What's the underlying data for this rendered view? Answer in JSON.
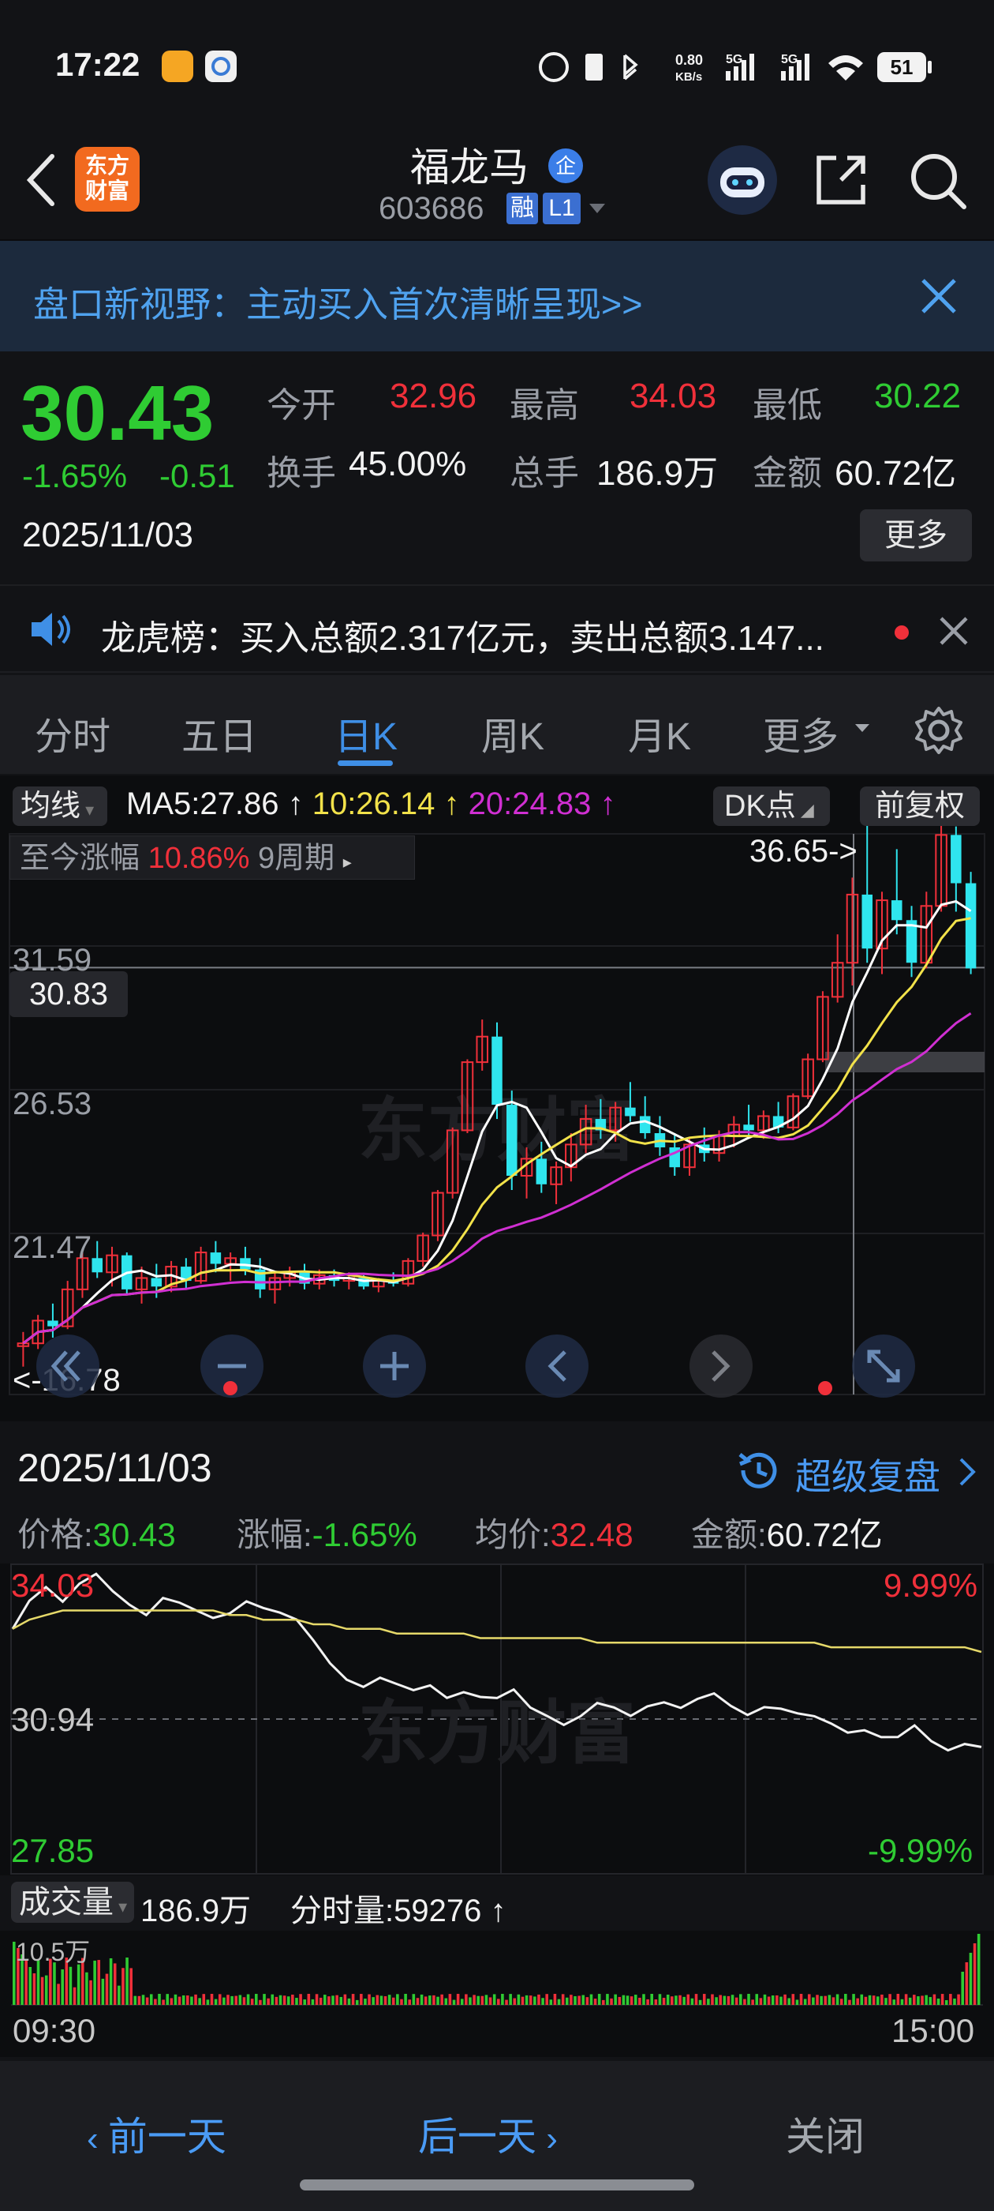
{
  "status_bar": {
    "time": "17:22",
    "net_speed": "0.80",
    "net_unit": "KB/s",
    "sig1": "5G",
    "sig2": "5G",
    "battery": "51"
  },
  "header": {
    "logo_line1": "东方",
    "logo_line2": "财富",
    "stock_name": "福龙马",
    "badge": "企",
    "code": "603686",
    "tag1": "融",
    "tag2": "L1"
  },
  "banner": {
    "text": "盘口新视野：主动买入首次清晰呈现>>"
  },
  "quote": {
    "price": "30.43",
    "change_pct": "-1.65%",
    "change": "-0.51",
    "date": "2025/11/03",
    "open_label": "今开",
    "open": "32.96",
    "high_label": "最高",
    "high": "34.03",
    "low_label": "最低",
    "low": "30.22",
    "turnover_label": "换手",
    "turnover": "45.00%",
    "volume_label": "总手",
    "volume": "186.9万",
    "amount_label": "金额",
    "amount": "60.72亿",
    "more": "更多"
  },
  "news": {
    "text": "龙虎榜：买入总额2.317亿元，卖出总额3.147..."
  },
  "tabs": [
    "分时",
    "五日",
    "日K",
    "周K",
    "月K",
    "更多"
  ],
  "active_tab": "日K",
  "kchart": {
    "ma_chip": "均线",
    "ma5": "MA5:27.86",
    "ma10": "10:26.14",
    "ma20": "20:24.83",
    "dk_chip": "DK点",
    "adj_chip": "前复权",
    "range_label": "至今涨幅",
    "range_pct": "10.86%",
    "range_period": "9周期",
    "high_marker": "36.65->",
    "low_marker": "<-16.78",
    "price_label": "30.83",
    "y_labels": [
      "31.59",
      "26.53",
      "21.47"
    ],
    "watermark": "东方财富",
    "colors": {
      "up": "#f0303a",
      "down": "#2fe5ee",
      "ma5": "#ffffff",
      "ma10": "#f2e24a",
      "ma20": "#d02fd2"
    }
  },
  "daybar": {
    "date": "2025/11/03",
    "replay": "超级复盘",
    "price_label": "价格:",
    "price": "30.43",
    "chg_label": "涨幅:",
    "chg": "-1.65%",
    "avg_label": "均价:",
    "avg": "32.48",
    "amt_label": "金额:",
    "amt": "60.72亿"
  },
  "intraday": {
    "top": "34.03",
    "mid": "30.94",
    "bottom": "27.85",
    "top_pct": "9.99%",
    "bottom_pct": "-9.99%",
    "watermark": "东方财富"
  },
  "volume": {
    "chip": "成交量",
    "total": "186.9万",
    "tick_label": "分时量:59276",
    "scale": "10.5万",
    "start": "09:30",
    "end": "15:00"
  },
  "bottom_nav": {
    "prev": "前一天",
    "next": "后一天",
    "close": "关闭"
  },
  "chart_data": [
    {
      "type": "candlestick",
      "title": "日K",
      "y_labels": [
        31.59,
        26.53,
        21.47
      ],
      "max_marker": 36.65,
      "min_marker": 16.78,
      "cursor_price": 30.83,
      "ma": {
        "MA5": 27.86,
        "MA10": 26.14,
        "MA20": 24.83
      },
      "ohlc": [
        [
          17.5,
          18.0,
          16.78,
          17.6
        ],
        [
          17.6,
          18.6,
          17.4,
          18.4
        ],
        [
          18.4,
          19.0,
          17.8,
          18.2
        ],
        [
          18.2,
          19.8,
          18.1,
          19.5
        ],
        [
          19.5,
          20.8,
          19.2,
          20.6
        ],
        [
          20.6,
          21.2,
          19.9,
          20.1
        ],
        [
          20.1,
          21.0,
          19.6,
          20.7
        ],
        [
          20.7,
          20.8,
          19.3,
          19.5
        ],
        [
          19.5,
          20.3,
          19.0,
          19.9
        ],
        [
          19.9,
          20.4,
          19.2,
          19.6
        ],
        [
          19.6,
          20.5,
          19.4,
          20.3
        ],
        [
          20.3,
          20.6,
          19.5,
          19.8
        ],
        [
          19.8,
          21.0,
          19.7,
          20.8
        ],
        [
          20.8,
          21.2,
          20.1,
          20.4
        ],
        [
          20.4,
          20.8,
          19.8,
          20.6
        ],
        [
          20.6,
          21.0,
          20.0,
          20.2
        ],
        [
          20.2,
          20.6,
          19.2,
          19.5
        ],
        [
          19.5,
          20.1,
          19.0,
          19.9
        ],
        [
          19.9,
          20.3,
          19.6,
          20.1
        ],
        [
          20.1,
          20.4,
          19.5,
          19.7
        ],
        [
          19.7,
          20.2,
          19.5,
          20.0
        ],
        [
          20.0,
          20.2,
          19.6,
          19.8
        ],
        [
          19.8,
          20.1,
          19.5,
          19.9
        ],
        [
          19.9,
          20.0,
          19.5,
          19.6
        ],
        [
          19.6,
          19.9,
          19.4,
          19.8
        ],
        [
          19.8,
          20.1,
          19.6,
          19.7
        ],
        [
          19.7,
          20.6,
          19.6,
          20.5
        ],
        [
          20.5,
          21.5,
          20.3,
          21.4
        ],
        [
          21.4,
          23.0,
          21.2,
          22.9
        ],
        [
          22.9,
          25.2,
          22.7,
          25.1
        ],
        [
          25.1,
          27.6,
          25.0,
          27.5
        ],
        [
          27.5,
          29.0,
          27.2,
          28.4
        ],
        [
          28.4,
          28.9,
          25.5,
          26.0
        ],
        [
          26.0,
          26.5,
          23.0,
          23.5
        ],
        [
          23.5,
          24.5,
          22.7,
          24.1
        ],
        [
          24.1,
          24.7,
          22.9,
          23.2
        ],
        [
          23.2,
          24.0,
          22.5,
          23.8
        ],
        [
          23.8,
          25.0,
          23.3,
          24.6
        ],
        [
          24.6,
          26.0,
          24.3,
          25.5
        ],
        [
          25.5,
          26.2,
          24.8,
          25.1
        ],
        [
          25.1,
          26.1,
          24.7,
          25.9
        ],
        [
          25.9,
          26.8,
          25.4,
          25.6
        ],
        [
          25.6,
          26.3,
          24.8,
          25.0
        ],
        [
          25.0,
          25.6,
          24.2,
          24.5
        ],
        [
          24.5,
          25.0,
          23.5,
          23.8
        ],
        [
          23.8,
          24.8,
          23.5,
          24.6
        ],
        [
          24.6,
          25.2,
          24.0,
          24.3
        ],
        [
          24.3,
          25.1,
          24.0,
          24.9
        ],
        [
          24.9,
          25.6,
          24.5,
          25.3
        ],
        [
          25.3,
          26.0,
          24.9,
          25.1
        ],
        [
          25.1,
          25.8,
          24.8,
          25.6
        ],
        [
          25.6,
          26.1,
          25.0,
          25.2
        ],
        [
          25.2,
          26.4,
          25.1,
          26.3
        ],
        [
          26.3,
          27.8,
          26.2,
          27.6
        ],
        [
          27.6,
          30.0,
          27.5,
          29.8
        ],
        [
          29.8,
          32.0,
          29.6,
          31.0
        ],
        [
          31.0,
          34.0,
          30.2,
          33.4
        ],
        [
          33.4,
          36.65,
          31.0,
          31.5
        ],
        [
          31.5,
          33.5,
          30.6,
          33.2
        ],
        [
          33.2,
          35.0,
          32.0,
          32.5
        ],
        [
          32.5,
          33.0,
          30.5,
          31.0
        ],
        [
          31.0,
          33.5,
          30.8,
          33.0
        ],
        [
          33.0,
          36.0,
          32.8,
          35.5
        ],
        [
          35.5,
          35.8,
          32.8,
          33.8
        ],
        [
          33.8,
          34.2,
          30.6,
          30.8
        ]
      ]
    },
    {
      "type": "line",
      "title": "分时",
      "x_labels": [
        "09:30",
        "15:00"
      ],
      "y_labels": [
        34.03,
        30.94,
        27.85
      ],
      "pct_labels": [
        "9.99%",
        "-9.99%"
      ],
      "series": [
        {
          "values": [
            32.9,
            33.6,
            33.9,
            33.5,
            33.8,
            34.0,
            33.7,
            33.5,
            33.3,
            33.6,
            33.4,
            33.2,
            33.1,
            33.3,
            33.6,
            33.4,
            33.2,
            33.0,
            32.6,
            32.2,
            31.9,
            31.7,
            31.8,
            31.6,
            31.5,
            31.7,
            31.5,
            31.6,
            31.4,
            31.3,
            31.5,
            31.2,
            31.1,
            30.9,
            31.0,
            31.2,
            31.1,
            31.0,
            31.3,
            31.4,
            31.2,
            31.3,
            31.4,
            31.2,
            31.1,
            31.3,
            31.2,
            31.0,
            30.9,
            30.8,
            30.7,
            30.8,
            30.6,
            30.5,
            30.7,
            30.4,
            30.3,
            30.5,
            30.4
          ]
        },
        {
          "values": [
            32.9,
            33.1,
            33.2,
            33.3,
            33.3,
            33.3,
            33.3,
            33.3,
            33.3,
            33.3,
            33.3,
            33.3,
            33.3,
            33.2,
            33.2,
            33.1,
            33.1,
            33.1,
            33.0,
            33.0,
            32.9,
            32.9,
            32.9,
            32.8,
            32.8,
            32.8,
            32.8,
            32.8,
            32.7,
            32.7,
            32.7,
            32.7,
            32.7,
            32.7,
            32.7,
            32.6,
            32.6,
            32.6,
            32.6,
            32.6,
            32.6,
            32.6,
            32.6,
            32.6,
            32.6,
            32.6,
            32.6,
            32.6,
            32.6,
            32.5,
            32.5,
            32.5,
            32.5,
            32.5,
            32.5,
            32.5,
            32.5,
            32.5,
            32.4
          ]
        }
      ]
    }
  ]
}
